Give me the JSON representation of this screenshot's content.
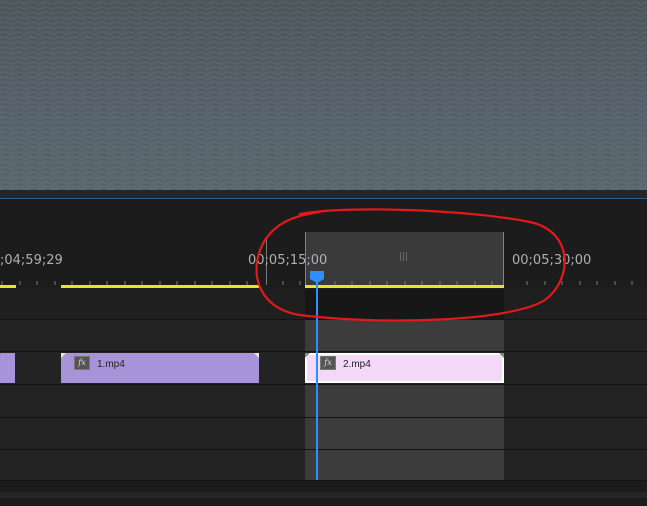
{
  "ruler": {
    "timecodes": [
      ";04;59;29",
      "00;05;15;00",
      "00;05;30;00"
    ],
    "work_area_grip": "|||"
  },
  "tracks": {
    "clips": [
      {
        "label": "1.mp4",
        "fx": "fx"
      },
      {
        "label": "2.mp4",
        "fx": "fx"
      }
    ]
  },
  "colors": {
    "clip_1": "#a794d8",
    "clip_2": "#f3d9f7",
    "playhead": "#2f8fff",
    "render_bar": "#e5e52a",
    "annotation": "#e11a1a"
  }
}
